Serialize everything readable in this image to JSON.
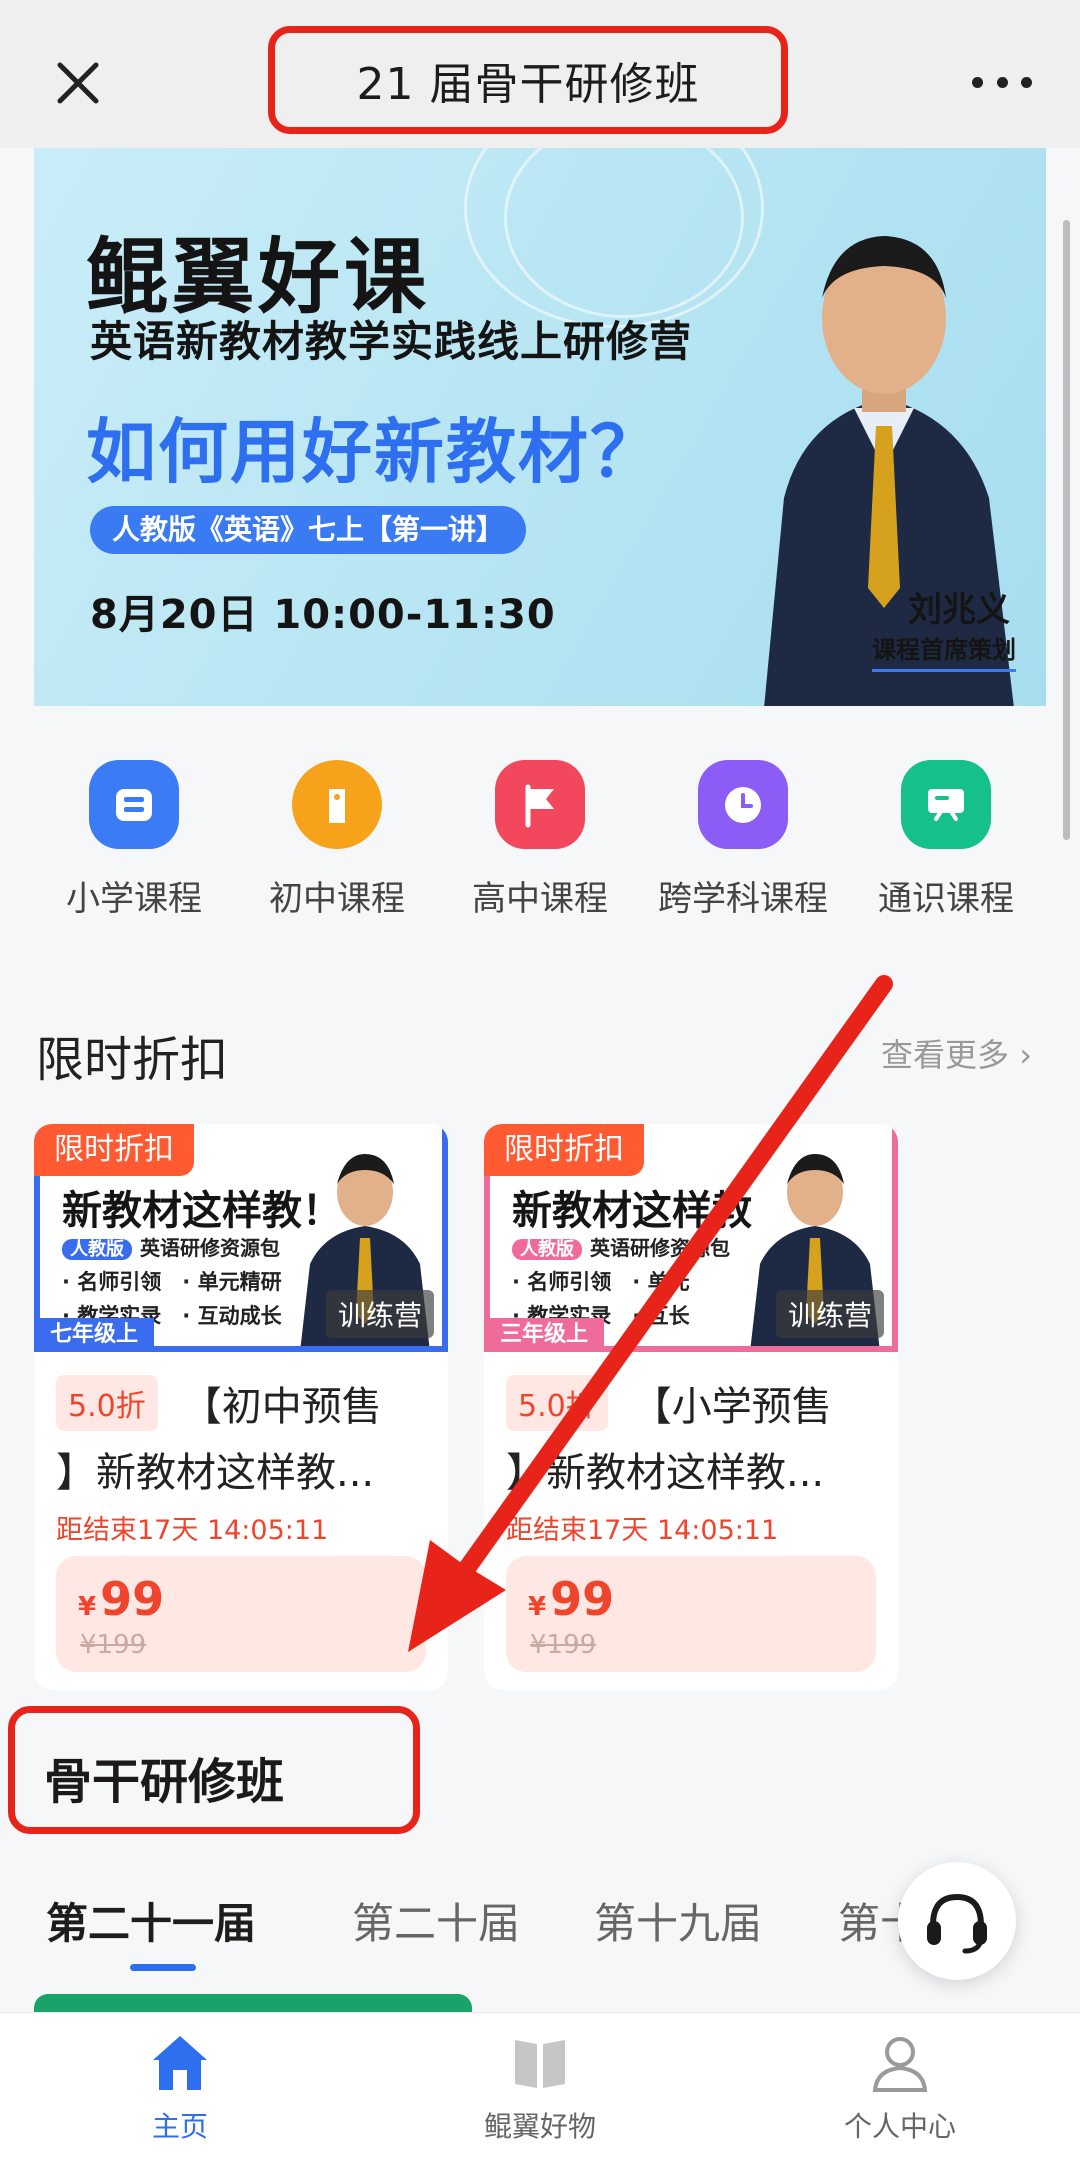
{
  "header": {
    "title": "21 届骨干研修班"
  },
  "banner": {
    "brand": "鲲翼好课",
    "subtitle": "英语新教材教学实践线上研修营",
    "headline": "如何用好新教材？",
    "pill": "人教版《英语》七上【第一讲】",
    "datetime": "8月20日 10:00-11:30",
    "teacher_name": "刘兆义",
    "teacher_role": "课程首席策划"
  },
  "categories": [
    {
      "label": "小学课程",
      "icon": "book-icon",
      "color": "#3b7bf5"
    },
    {
      "label": "初中课程",
      "icon": "tag-icon",
      "color": "#f7a21b"
    },
    {
      "label": "高中课程",
      "icon": "flag-icon",
      "color": "#f2475d"
    },
    {
      "label": "跨学科课程",
      "icon": "clock-icon",
      "color": "#8b5cf6"
    },
    {
      "label": "通识课程",
      "icon": "board-icon",
      "color": "#16c08a"
    }
  ],
  "discount": {
    "title": "限时折扣",
    "see_more": "查看更多 ›",
    "cards": [
      {
        "tag": "限时折扣",
        "thumb_title": "新教材这样教！",
        "thumb_chip": "人教版",
        "thumb_chip_text": "英语研修资源包",
        "bullets": [
          "· 名师引领　· 单元精研",
          "· 教学实录　· 互动成长"
        ],
        "grade": "七年级上",
        "badge": "训练营",
        "accent": "#3a6cf0",
        "discount": "5.0折",
        "name_line1": "【初中预售",
        "name_line2": "】新教材这样教...",
        "countdown": "距结束17天 14:05:11",
        "currency": "¥",
        "price": "99",
        "original_price": "¥199"
      },
      {
        "tag": "限时折扣",
        "thumb_title": "新教材这样教",
        "thumb_chip": "人教版",
        "thumb_chip_text": "英语研修资源包",
        "bullets": [
          "· 名师引领　· 单元",
          "· 教学实录　· 互长"
        ],
        "grade": "三年级上",
        "badge": "训练营",
        "accent": "#ef6c9a",
        "discount": "5.0折",
        "name_line1": "【小学预售",
        "name_line2": "】新教材这样教...",
        "countdown": "距结束17天 14:05:11",
        "currency": "¥",
        "price": "99",
        "original_price": "¥199"
      }
    ]
  },
  "section2": {
    "title": "骨干研修班",
    "tabs": [
      "第二十一届",
      "第二十届",
      "第十九届",
      "第十"
    ],
    "active_tab": 0
  },
  "bottom_nav": [
    {
      "label": "主页",
      "icon": "home-icon",
      "active": true
    },
    {
      "label": "鲲翼好物",
      "icon": "book-open-icon",
      "active": false
    },
    {
      "label": "个人中心",
      "icon": "user-icon",
      "active": false
    }
  ],
  "colors": {
    "accent_blue": "#2e6ff0",
    "annotation_red": "#e8231a",
    "price_red": "#f0452d"
  }
}
